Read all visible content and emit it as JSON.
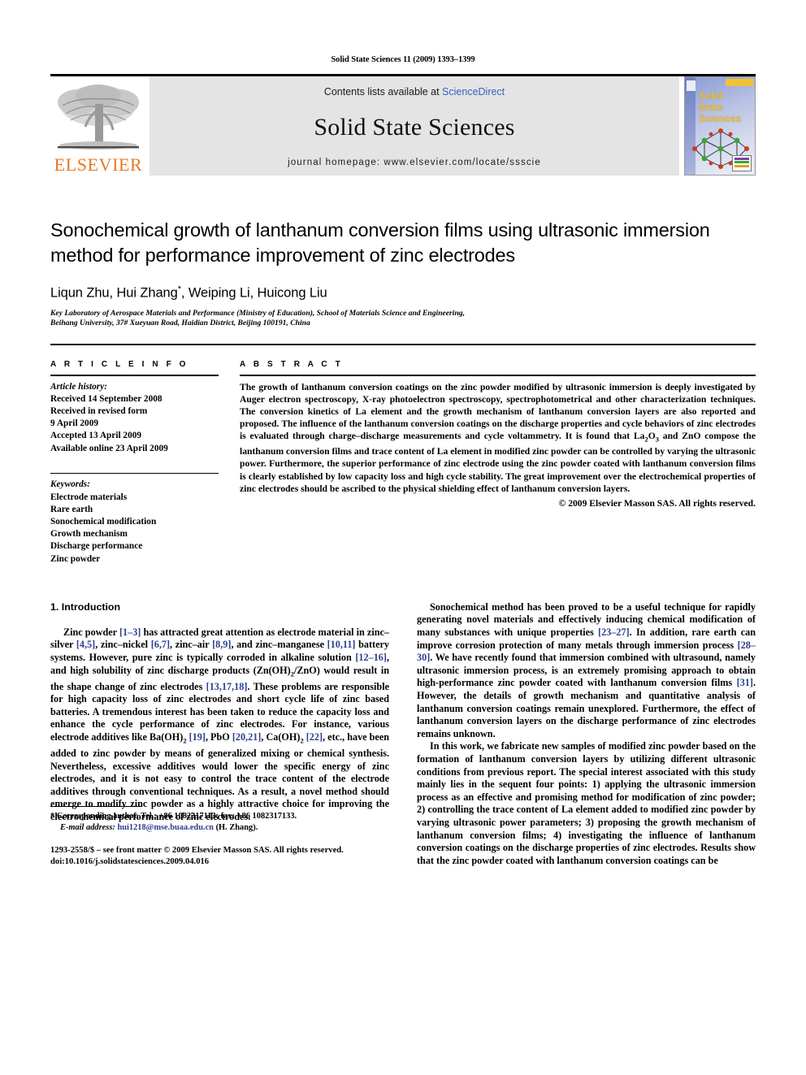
{
  "running_head": "Solid State Sciences 11 (2009) 1393–1399",
  "header": {
    "publisher_name": "ELSEVIER",
    "contents_prefix": "Contents lists available at ",
    "sciencedirect": "ScienceDirect",
    "journal_title": "Solid State Sciences",
    "homepage": "journal homepage: www.elsevier.com/locate/ssscie",
    "cover_title_line1": "Solid",
    "cover_title_line2": "State",
    "cover_title_line3": "Sciences"
  },
  "article": {
    "title": "Sonochemical growth of lanthanum conversion films using ultrasonic immersion method for performance improvement of zinc electrodes",
    "authors": "Liqun Zhu, Hui Zhang",
    "authors_star": "*",
    "authors_rest": ", Weiping Li, Huicong Liu",
    "affiliation_line1": "Key Laboratory of Aerospace Materials and Performance (Ministry of Education), School of Materials Science and Engineering,",
    "affiliation_line2": "Beihang University, 37# Xueyuan Road, Haidian District, Beijing 100191, China"
  },
  "article_info": {
    "heading": "A R T I C L E   I N F O",
    "history_label": "Article history:",
    "history": [
      "Received 14 September 2008",
      "Received in revised form",
      "9 April 2009",
      "Accepted 13 April 2009",
      "Available online 23 April 2009"
    ],
    "keywords_label": "Keywords:",
    "keywords": [
      "Electrode materials",
      "Rare earth",
      "Sonochemical modification",
      "Growth mechanism",
      "Discharge performance",
      "Zinc powder"
    ]
  },
  "abstract": {
    "heading": "A B S T R A C T",
    "text": "The growth of lanthanum conversion coatings on the zinc powder modified by ultrasonic immersion is deeply investigated by Auger electron spectroscopy, X-ray photoelectron spectroscopy, spectrophotometrical and other characterization techniques. The conversion kinetics of La element and the growth mechanism of lanthanum conversion layers are also reported and proposed. The influence of the lanthanum conversion coatings on the discharge properties and cycle behaviors of zinc electrodes is evaluated through charge–discharge measurements and cycle voltammetry. It is found that La2O3 and ZnO compose the lanthanum conversion films and trace content of La element in modified zinc powder can be controlled by varying the ultrasonic power. Furthermore, the superior performance of zinc electrode using the zinc powder coated with lanthanum conversion films is clearly established by low capacity loss and high cycle stability. The great improvement over the electrochemical properties of zinc electrodes should be ascribed to the physical shielding effect of lanthanum conversion layers.",
    "copyright": "© 2009 Elsevier Masson SAS. All rights reserved."
  },
  "introduction": {
    "section_number_title": "1.  Introduction",
    "left_paragraph_1": "Zinc powder [1–3] has attracted great attention as electrode material in zinc–silver [4,5], zinc–nickel [6,7], zinc–air [8,9], and zinc–manganese [10,11] battery systems. However, pure zinc is typically corroded in alkaline solution [12–16], and high solubility of zinc discharge products (Zn(OH)2/ZnO) would result in the shape change of zinc electrodes [13,17,18]. These problems are responsible for high capacity loss of zinc electrodes and short cycle life of zinc based batteries. A tremendous interest has been taken to reduce the capacity loss and enhance the cycle performance of zinc electrodes. For instance, various electrode additives like Ba(OH)2 [19], PbO [20,21], Ca(OH)2 [22], etc., have been added to zinc powder by means of generalized mixing or chemical synthesis. Nevertheless, excessive additives would lower the specific energy of zinc electrodes, and it is not easy to control the trace content of the electrode additives through conventional techniques. As a result, a novel method should emerge to modify zinc powder as a highly attractive choice for improving the electrochemical performance of zinc electrodes.",
    "right_paragraph_1": "Sonochemical method has been proved to be a useful technique for rapidly generating novel materials and effectively inducing chemical modification of many substances with unique properties [23–27]. In addition, rare earth can improve corrosion protection of many metals through immersion process [28–30]. We have recently found that immersion combined with ultrasound, namely ultrasonic immersion process, is an extremely promising approach to obtain high-performance zinc powder coated with lanthanum conversion films [31]. However, the details of growth mechanism and quantitative analysis of lanthanum conversion coatings remain unexplored. Furthermore, the effect of lanthanum conversion layers on the discharge performance of zinc electrodes remains unknown.",
    "right_paragraph_2": "In this work, we fabricate new samples of modified zinc powder based on the formation of lanthanum conversion layers by utilizing different ultrasonic conditions from previous report. The special interest associated with this study mainly lies in the sequent four points: 1) applying the ultrasonic immersion process as an effective and promising method for modification of zinc powder; 2) controlling the trace content of La element added to modified zinc powder by varying ultrasonic power parameters; 3) proposing the growth mechanism of lanthanum conversion films; 4) investigating the influence of lanthanum conversion coatings on the discharge properties of zinc electrodes. Results show that the zinc powder coated with lanthanum conversion coatings can be"
  },
  "footnote": {
    "marker": "*",
    "corresponding": "Corresponding author. Tel.: +86 1082317113; fax: +86 1082317133.",
    "email_label": "E-mail address:",
    "email": "hui1218@mse.buaa.edu.cn",
    "email_owner": "(H. Zhang).",
    "issn_line": "1293-2558/$ – see front matter © 2009 Elsevier Masson SAS. All rights reserved.",
    "doi_line": "doi:10.1016/j.solidstatesciences.2009.04.016"
  },
  "colors": {
    "reference_blue": "#2b3f8c",
    "sciencedirect_blue": "#3b5fc0",
    "elsevier_orange": "#e87722",
    "band_gray": "#e4e4e4",
    "cover_yellow": "#f2c230"
  }
}
